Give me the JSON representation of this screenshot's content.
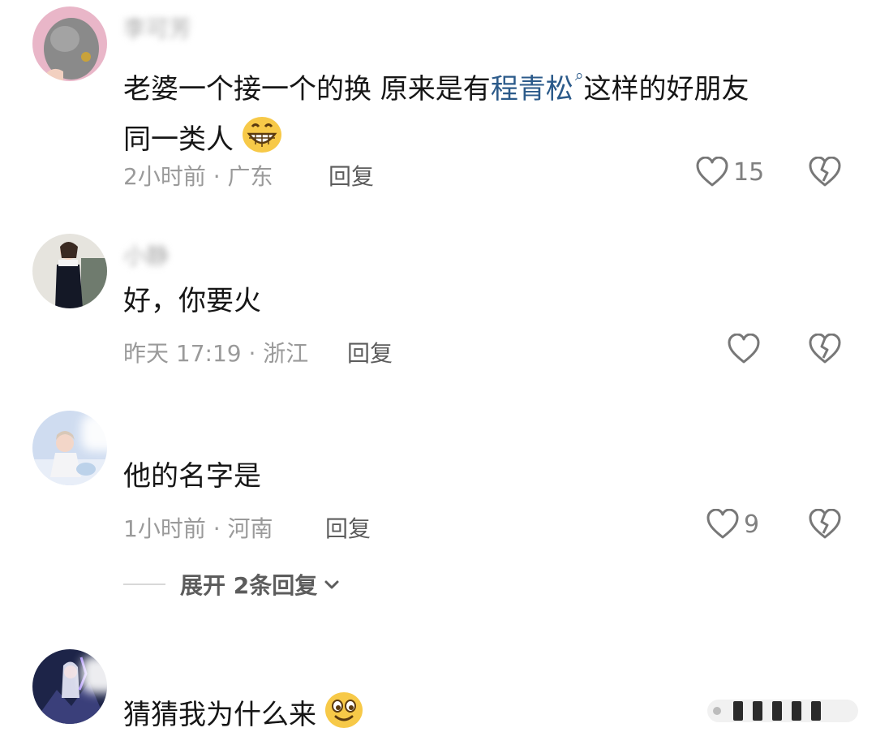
{
  "comments": [
    {
      "username": "李可芳",
      "text_before": "老婆一个接一个的换 原来是有",
      "link_text": "程青松",
      "search_hint_icon": "search-icon",
      "text_after": "这样的好朋友",
      "text_line2": "同一类人",
      "emoji": "grinning-face-emoji",
      "time": "2小时前",
      "location": "广东",
      "reply_label": "回复",
      "likes": "15"
    },
    {
      "username": "小静",
      "text": "好，你要火",
      "time": "昨天 17:19",
      "location": "浙江",
      "reply_label": "回复",
      "likes": ""
    },
    {
      "username": "",
      "text": "他的名字是",
      "time": "1小时前",
      "location": "河南",
      "reply_label": "回复",
      "likes": "9",
      "expand_label": "展开 2条回复"
    },
    {
      "username": "",
      "text": "猜猜我为什么来",
      "emoji": "smiling-face-emoji"
    }
  ],
  "meta_separator": " · ",
  "icons": {
    "like": "heart-outline-icon",
    "dislike": "broken-heart-icon",
    "expand": "chevron-down-icon"
  },
  "colors": {
    "link": "#2b5a8a",
    "meta": "#9a9a9a",
    "action": "#5c5c5c"
  }
}
